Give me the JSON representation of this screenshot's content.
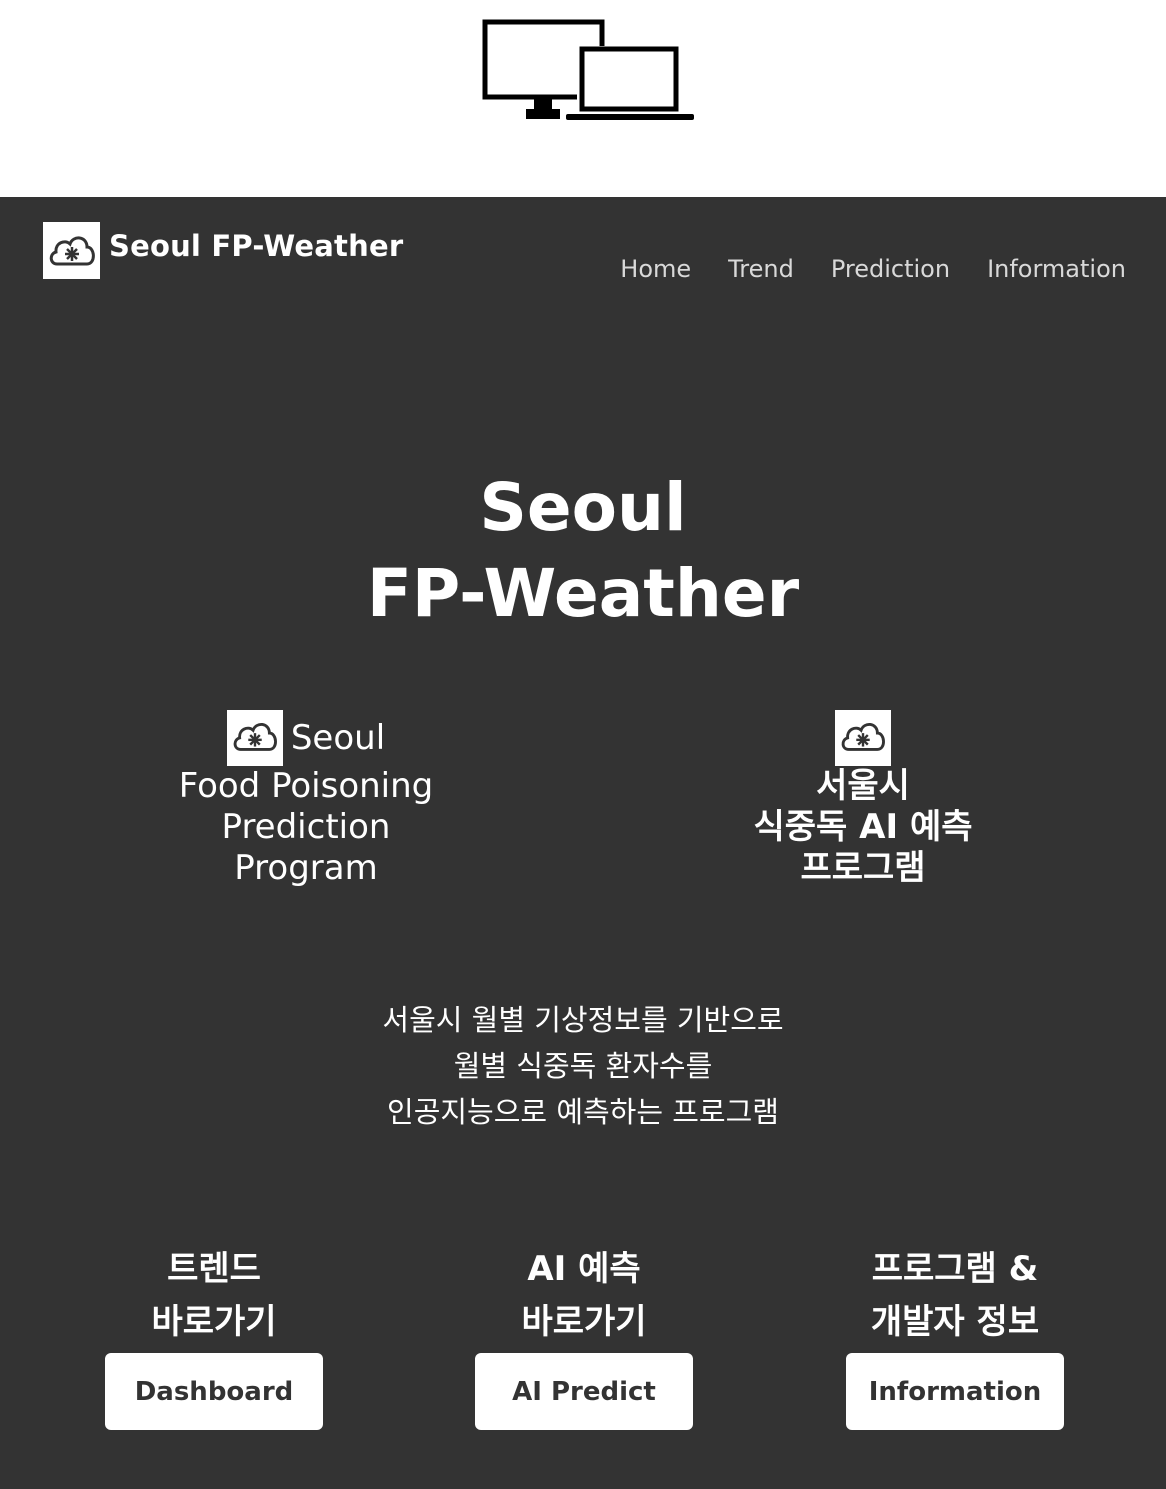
{
  "brand": {
    "name": "Seoul FP-Weather",
    "logo_icon": "cloud-snowflake-icon"
  },
  "nav": {
    "items": [
      "Home",
      "Trend",
      "Prediction",
      "Information"
    ]
  },
  "hero": {
    "title_line1": "Seoul",
    "title_line2": "FP-Weather"
  },
  "features": {
    "left": {
      "lines": [
        "Seoul",
        "Food Poisoning",
        "Prediction",
        "Program"
      ]
    },
    "right": {
      "lines": [
        "서울시",
        "식중독 AI 예측",
        "프로그램"
      ]
    }
  },
  "description": {
    "lines": [
      "서울시 월별 기상정보를 기반으로",
      "월별 식중독 환자수를",
      "인공지능으로 예측하는 프로그램"
    ]
  },
  "cta": [
    {
      "label_lines": [
        "트렌드",
        "바로가기"
      ],
      "button": "Dashboard"
    },
    {
      "label_lines": [
        "AI 예측",
        "바로가기"
      ],
      "button": "AI Predict"
    },
    {
      "label_lines": [
        "프로그램 &",
        "개발자 정보"
      ],
      "button": "Information"
    }
  ],
  "colors": {
    "background": "#333333",
    "text": "#ffffff",
    "nav_text": "#d9d9d9",
    "button_bg": "#ffffff",
    "button_text": "#333333"
  }
}
